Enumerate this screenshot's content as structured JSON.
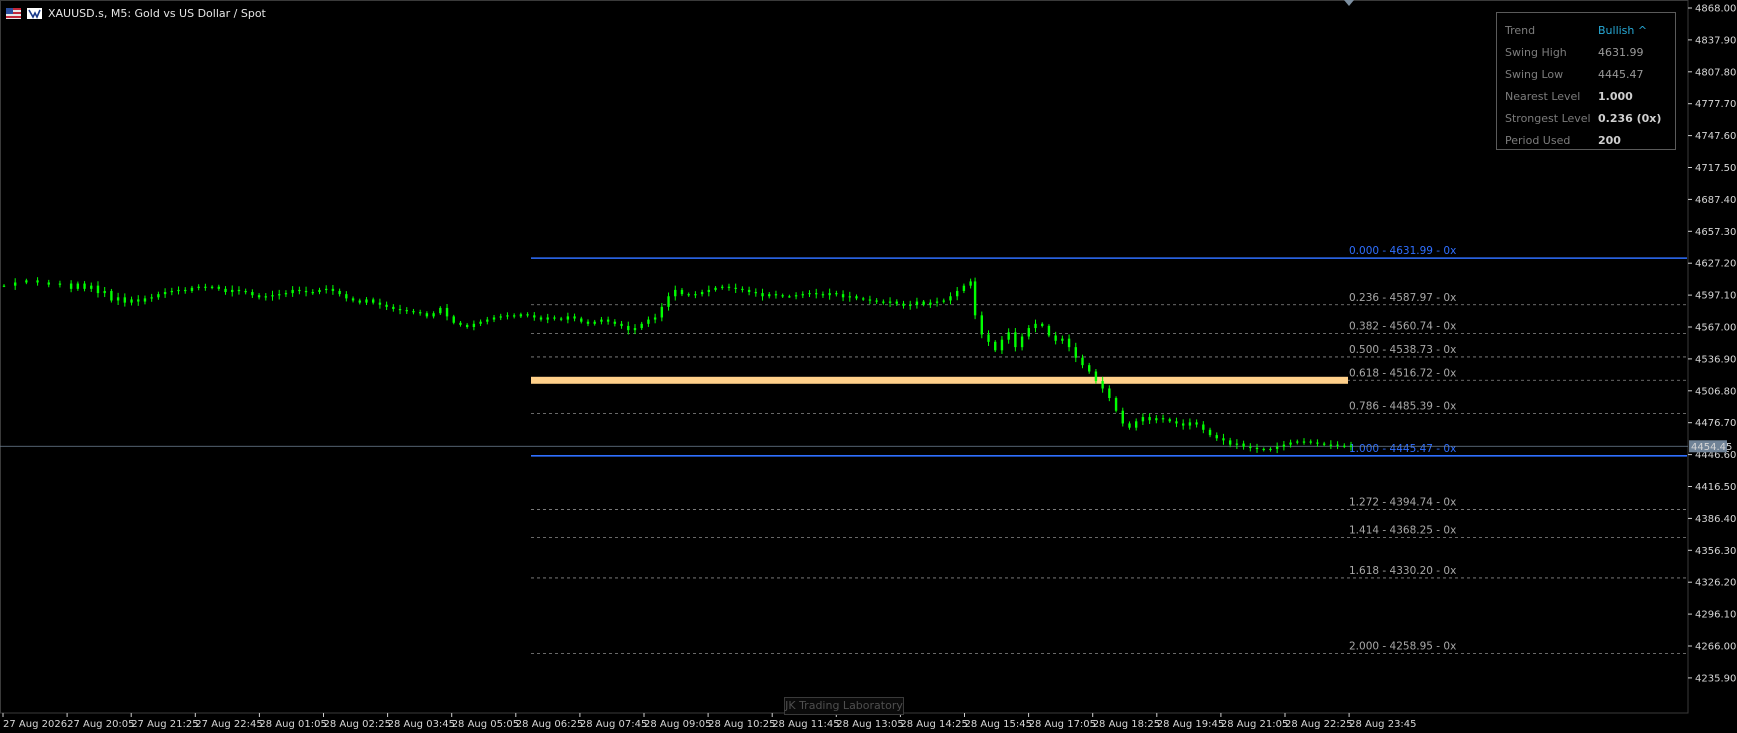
{
  "window": {
    "title": "XAUUSD.s, M5:  Gold vs US Dollar / Spot"
  },
  "info_panel": {
    "rows": [
      {
        "key": "Trend",
        "value": "Bullish ^"
      },
      {
        "key": "Swing High",
        "value": "4631.99"
      },
      {
        "key": "Swing Low",
        "value": "4445.47"
      },
      {
        "key": "Nearest Level",
        "value": "1.000"
      },
      {
        "key": "Strongest Level",
        "value": "0.236 (0x)"
      },
      {
        "key": "Period Used",
        "value": "200"
      }
    ]
  },
  "watermark": "JK Trading Laboratory",
  "price_axis": {
    "ticks": [
      "4868.00",
      "4837.90",
      "4807.80",
      "4777.70",
      "4747.60",
      "4717.50",
      "4687.40",
      "4657.30",
      "4627.20",
      "4597.10",
      "4567.00",
      "4536.90",
      "4506.80",
      "4476.70",
      "4446.60",
      "4416.50",
      "4386.40",
      "4356.30",
      "4326.20",
      "4296.10",
      "4266.00",
      "4235.90"
    ],
    "current_price": "4454.45"
  },
  "time_axis": {
    "ticks": [
      "27 Aug 2026",
      "27 Aug 20:05",
      "27 Aug 21:25",
      "27 Aug 22:45",
      "28 Aug 01:05",
      "28 Aug 02:25",
      "28 Aug 03:45",
      "28 Aug 05:05",
      "28 Aug 06:25",
      "28 Aug 07:45",
      "28 Aug 09:05",
      "28 Aug 10:25",
      "28 Aug 11:45",
      "28 Aug 13:05",
      "28 Aug 14:25",
      "28 Aug 15:45",
      "28 Aug 17:05",
      "28 Aug 18:25",
      "28 Aug 19:45",
      "28 Aug 21:05",
      "28 Aug 22:25",
      "28 Aug 23:45"
    ]
  },
  "fibonacci": {
    "levels": [
      {
        "ratio": 0.0,
        "price": 4631.99,
        "label": "0.000 - 4631.99 - 0x"
      },
      {
        "ratio": 0.236,
        "price": 4587.97,
        "label": "0.236 - 4587.97 - 0x"
      },
      {
        "ratio": 0.382,
        "price": 4560.74,
        "label": "0.382 - 4560.74 - 0x"
      },
      {
        "ratio": 0.5,
        "price": 4538.73,
        "label": "0.500 - 4538.73 - 0x"
      },
      {
        "ratio": 0.618,
        "price": 4516.72,
        "label": "0.618 - 4516.72 - 0x"
      },
      {
        "ratio": 0.786,
        "price": 4485.39,
        "label": "0.786 - 4485.39 - 0x"
      },
      {
        "ratio": 1.0,
        "price": 4445.47,
        "label": "1.000 - 4445.47 - 0x"
      },
      {
        "ratio": 1.272,
        "price": 4394.74,
        "label": "1.272 - 4394.74 - 0x"
      },
      {
        "ratio": 1.414,
        "price": 4368.25,
        "label": "1.414 - 4368.25 - 0x"
      },
      {
        "ratio": 1.618,
        "price": 4330.2,
        "label": "1.618 - 4330.20 - 0x"
      },
      {
        "ratio": 2.0,
        "price": 4258.95,
        "label": "2.000 - 4258.95 - 0x"
      }
    ],
    "golden_zone_ratio": 0.618
  },
  "colors": {
    "background": "#000000",
    "candle": "#00ff00",
    "fib_edge": "#2f6fff",
    "fib_dashed": "#8a8a8a",
    "golden_zone": "#ffd08a",
    "accent": "#27a9d6"
  },
  "chart_data": {
    "type": "candlestick",
    "ylim": [
      4235.9,
      4868.0
    ],
    "price_path": [
      [
        0,
        4606
      ],
      [
        5,
        4609
      ],
      [
        10,
        4611
      ],
      [
        15,
        4609
      ],
      [
        20,
        4607
      ],
      [
        25,
        4608
      ],
      [
        30,
        4603
      ],
      [
        33,
        4608
      ],
      [
        36,
        4603
      ],
      [
        39,
        4606
      ],
      [
        42,
        4599
      ],
      [
        45,
        4601
      ],
      [
        48,
        4592
      ],
      [
        51,
        4595
      ],
      [
        54,
        4590
      ],
      [
        57,
        4593
      ],
      [
        60,
        4591
      ],
      [
        63,
        4594
      ],
      [
        66,
        4595
      ],
      [
        69,
        4598
      ],
      [
        72,
        4600
      ],
      [
        75,
        4601
      ],
      [
        78,
        4602
      ],
      [
        81,
        4601
      ],
      [
        84,
        4604
      ],
      [
        87,
        4605
      ],
      [
        90,
        4604
      ],
      [
        93,
        4605
      ],
      [
        96,
        4603
      ],
      [
        99,
        4600
      ],
      [
        102,
        4602
      ],
      [
        105,
        4601
      ],
      [
        108,
        4600
      ],
      [
        111,
        4597
      ],
      [
        114,
        4595
      ],
      [
        117,
        4596
      ],
      [
        120,
        4597
      ],
      [
        123,
        4598
      ],
      [
        126,
        4599
      ],
      [
        129,
        4602
      ],
      [
        132,
        4601
      ],
      [
        135,
        4600
      ],
      [
        138,
        4600
      ],
      [
        141,
        4602
      ],
      [
        144,
        4603
      ],
      [
        147,
        4601
      ],
      [
        150,
        4598
      ],
      [
        153,
        4594
      ],
      [
        156,
        4592
      ],
      [
        159,
        4590
      ],
      [
        162,
        4593
      ],
      [
        165,
        4590
      ],
      [
        168,
        4588
      ],
      [
        171,
        4586
      ],
      [
        174,
        4584
      ],
      [
        177,
        4583
      ],
      [
        180,
        4582
      ],
      [
        183,
        4581
      ],
      [
        186,
        4580
      ],
      [
        189,
        4577
      ],
      [
        192,
        4580
      ],
      [
        195,
        4585
      ],
      [
        198,
        4577
      ],
      [
        201,
        4571
      ],
      [
        204,
        4569
      ],
      [
        207,
        4567
      ],
      [
        210,
        4570
      ],
      [
        213,
        4572
      ],
      [
        216,
        4574
      ],
      [
        219,
        4576
      ],
      [
        222,
        4577
      ],
      [
        225,
        4578
      ],
      [
        228,
        4577
      ],
      [
        231,
        4579
      ],
      [
        234,
        4578
      ],
      [
        237,
        4576
      ],
      [
        240,
        4574
      ],
      [
        243,
        4576
      ],
      [
        246,
        4575
      ],
      [
        249,
        4574
      ],
      [
        252,
        4577
      ],
      [
        255,
        4575
      ],
      [
        258,
        4572
      ],
      [
        261,
        4570
      ],
      [
        264,
        4572
      ],
      [
        267,
        4574
      ],
      [
        270,
        4572
      ],
      [
        273,
        4570
      ],
      [
        276,
        4568
      ],
      [
        279,
        4564
      ],
      [
        282,
        4566
      ],
      [
        285,
        4570
      ],
      [
        288,
        4574
      ],
      [
        291,
        4576
      ],
      [
        294,
        4586
      ],
      [
        297,
        4596
      ],
      [
        300,
        4602
      ],
      [
        303,
        4598
      ],
      [
        306,
        4597
      ],
      [
        309,
        4598
      ],
      [
        312,
        4600
      ],
      [
        315,
        4602
      ],
      [
        318,
        4604
      ],
      [
        321,
        4605
      ],
      [
        324,
        4604
      ],
      [
        327,
        4603
      ],
      [
        330,
        4602
      ],
      [
        333,
        4600
      ],
      [
        336,
        4599
      ],
      [
        339,
        4596
      ],
      [
        342,
        4598
      ],
      [
        345,
        4597
      ],
      [
        348,
        4596
      ],
      [
        351,
        4596
      ],
      [
        354,
        4597
      ],
      [
        357,
        4598
      ],
      [
        360,
        4599
      ],
      [
        363,
        4598
      ],
      [
        366,
        4597
      ],
      [
        369,
        4599
      ],
      [
        372,
        4598
      ],
      [
        375,
        4595
      ],
      [
        378,
        4596
      ],
      [
        381,
        4594
      ],
      [
        384,
        4593
      ],
      [
        387,
        4592
      ],
      [
        390,
        4591
      ],
      [
        393,
        4590
      ],
      [
        396,
        4591
      ],
      [
        399,
        4589
      ],
      [
        402,
        4587
      ],
      [
        405,
        4588
      ],
      [
        408,
        4591
      ],
      [
        411,
        4588
      ],
      [
        414,
        4590
      ],
      [
        417,
        4591
      ],
      [
        420,
        4592
      ],
      [
        423,
        4596
      ],
      [
        426,
        4601
      ],
      [
        429,
        4606
      ],
      [
        432,
        4610
      ],
      [
        434,
        4578
      ],
      [
        437,
        4560
      ],
      [
        440,
        4553
      ],
      [
        443,
        4545
      ],
      [
        446,
        4555
      ],
      [
        449,
        4562
      ],
      [
        452,
        4548
      ],
      [
        455,
        4558
      ],
      [
        458,
        4566
      ],
      [
        461,
        4570
      ],
      [
        464,
        4568
      ],
      [
        467,
        4559
      ],
      [
        470,
        4554
      ],
      [
        473,
        4556
      ],
      [
        476,
        4548
      ],
      [
        479,
        4538
      ],
      [
        482,
        4531
      ],
      [
        485,
        4525
      ],
      [
        488,
        4516
      ],
      [
        491,
        4509
      ],
      [
        494,
        4500
      ],
      [
        497,
        4488
      ],
      [
        500,
        4476
      ],
      [
        503,
        4472
      ],
      [
        506,
        4478
      ],
      [
        509,
        4482
      ],
      [
        512,
        4479
      ],
      [
        515,
        4481
      ],
      [
        518,
        4480
      ],
      [
        521,
        4478
      ],
      [
        524,
        4476
      ],
      [
        527,
        4474
      ],
      [
        530,
        4477
      ],
      [
        533,
        4475
      ],
      [
        536,
        4470
      ],
      [
        539,
        4465
      ],
      [
        542,
        4462
      ],
      [
        545,
        4460
      ],
      [
        548,
        4456
      ],
      [
        551,
        4457
      ],
      [
        554,
        4454
      ],
      [
        557,
        4453
      ],
      [
        560,
        4452
      ],
      [
        563,
        4451
      ],
      [
        566,
        4452
      ],
      [
        569,
        4454
      ],
      [
        572,
        4456
      ],
      [
        575,
        4458
      ],
      [
        578,
        4459
      ],
      [
        581,
        4459
      ],
      [
        584,
        4458
      ],
      [
        587,
        4457
      ],
      [
        590,
        4456
      ],
      [
        593,
        4456
      ],
      [
        596,
        4455
      ],
      [
        599,
        4455
      ],
      [
        602,
        4454
      ]
    ],
    "price_path_x_note": "",
    "current_price": 4454.45
  }
}
